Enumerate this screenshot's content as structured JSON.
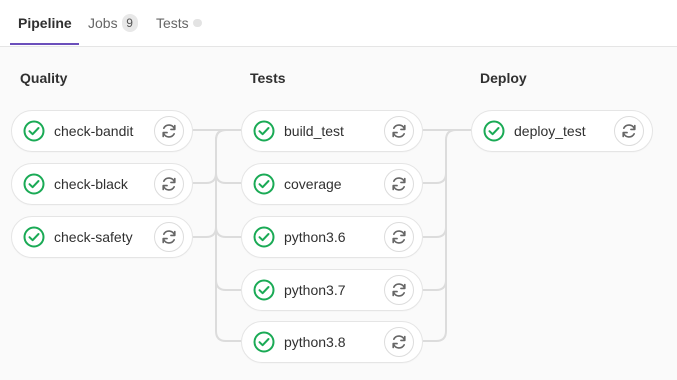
{
  "tabs": [
    {
      "label": "Pipeline",
      "active": true
    },
    {
      "label": "Jobs",
      "count": "9"
    },
    {
      "label": "Tests"
    }
  ],
  "stages": [
    {
      "title": "Quality",
      "jobs": [
        {
          "name": "check-bandit",
          "status": "passed",
          "icon": "check-circle-icon",
          "action": "retry-icon"
        },
        {
          "name": "check-black",
          "status": "passed",
          "icon": "check-circle-icon",
          "action": "retry-icon"
        },
        {
          "name": "check-safety",
          "status": "passed",
          "icon": "check-circle-icon",
          "action": "retry-icon"
        }
      ]
    },
    {
      "title": "Tests",
      "jobs": [
        {
          "name": "build_test",
          "status": "passed",
          "icon": "check-circle-icon",
          "action": "retry-icon"
        },
        {
          "name": "coverage",
          "status": "passed",
          "icon": "check-circle-icon",
          "action": "retry-icon"
        },
        {
          "name": "python3.6",
          "status": "passed",
          "icon": "check-circle-icon",
          "action": "retry-icon"
        },
        {
          "name": "python3.7",
          "status": "passed",
          "icon": "check-circle-icon",
          "action": "retry-icon"
        },
        {
          "name": "python3.8",
          "status": "passed",
          "icon": "check-circle-icon",
          "action": "retry-icon"
        }
      ]
    },
    {
      "title": "Deploy",
      "jobs": [
        {
          "name": "deploy_test",
          "status": "passed",
          "icon": "check-circle-icon",
          "action": "retry-icon"
        }
      ]
    }
  ],
  "colors": {
    "success": "#1aaa55",
    "tab_accent": "#6b4fbb",
    "connector": "#dcdcdc",
    "retry_icon": "#666666"
  }
}
